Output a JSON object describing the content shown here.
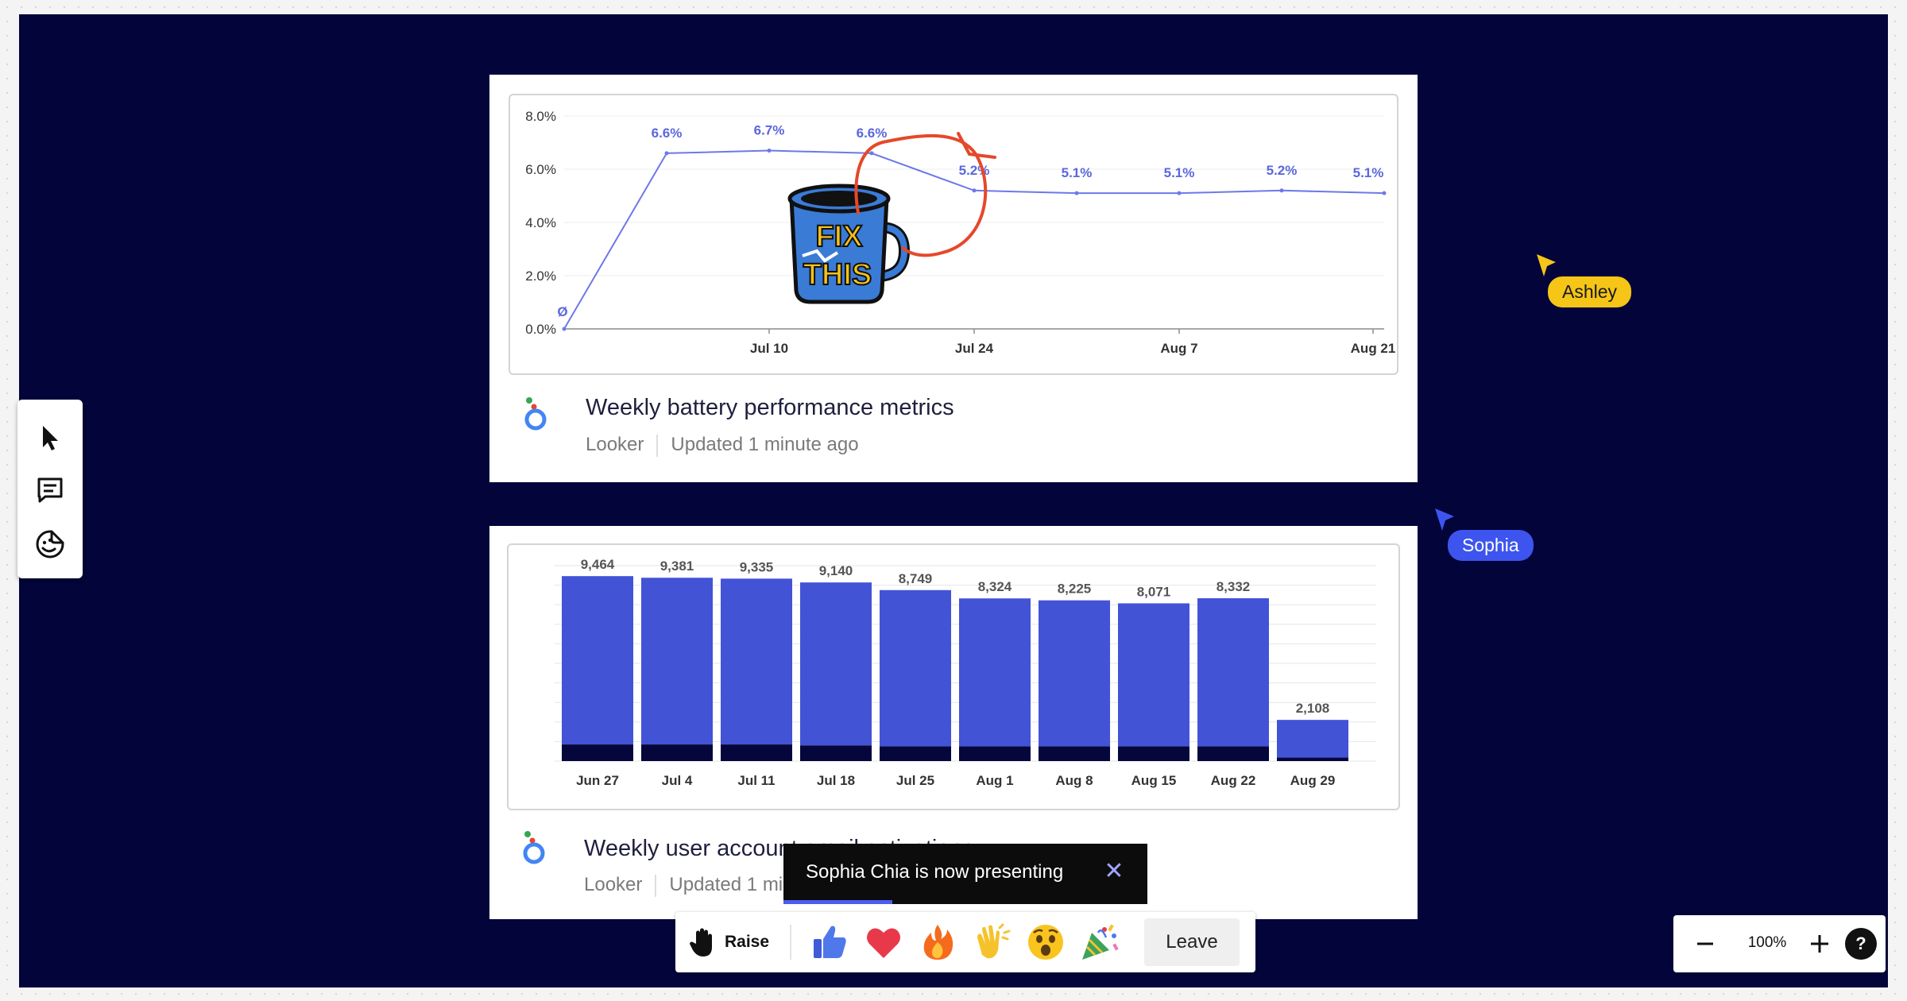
{
  "cards": [
    {
      "title": "Weekly battery performance metrics",
      "source": "Looker",
      "updated": "Updated 1 minute ago"
    },
    {
      "title": "Weekly user account email activations",
      "source": "Looker",
      "updated": "Updated 1 minute ago"
    }
  ],
  "chart_data": [
    {
      "type": "line",
      "x_labels": [
        "Jul 10",
        "Jul 24",
        "Aug 7",
        "Aug 21"
      ],
      "y_ticks": [
        "0.0%",
        "2.0%",
        "4.0%",
        "6.0%",
        "8.0%"
      ],
      "ylim": [
        0,
        8
      ],
      "grid": true,
      "series": [
        {
          "values": [
            0,
            6.6,
            6.7,
            6.6,
            5.2,
            5.1,
            5.1,
            5.2,
            5.1
          ],
          "labels": [
            "Ø",
            "6.6%",
            "6.7%",
            "6.6%",
            "5.2%",
            "5.1%",
            "5.1%",
            "5.2%",
            "5.1%"
          ],
          "color": "#6e78e8"
        }
      ]
    },
    {
      "type": "bar",
      "stacked": true,
      "categories": [
        "Jun 27",
        "Jul 4",
        "Jul 11",
        "Jul 18",
        "Jul 25",
        "Aug 1",
        "Aug 8",
        "Aug 15",
        "Aug 22",
        "Aug 29"
      ],
      "totals": [
        9464,
        9381,
        9335,
        9140,
        8749,
        8324,
        8225,
        8071,
        8332,
        2108
      ],
      "total_labels": [
        "9,464",
        "9,381",
        "9,335",
        "9,140",
        "8,749",
        "8,324",
        "8,225",
        "8,071",
        "8,332",
        "2,108"
      ],
      "base_values": [
        850,
        850,
        850,
        800,
        750,
        750,
        750,
        750,
        750,
        180
      ],
      "ylim": [
        0,
        10000
      ],
      "grid": true,
      "colors": {
        "top": "#4353d6",
        "base": "#05063b"
      }
    }
  ],
  "sticker": {
    "line1": "FIX",
    "line2": "THIS"
  },
  "cursors": [
    {
      "name": "Ashley",
      "color": "#f5c518"
    },
    {
      "name": "Sophia",
      "color": "#3d55ee"
    }
  ],
  "toast": {
    "message": "Sophia Chia is now presenting",
    "progress": 0.3
  },
  "reactions": {
    "raise_label": "Raise",
    "emojis": [
      "thumbs-up",
      "heart",
      "fire",
      "clapping-hands",
      "surprised-face",
      "party-popper"
    ],
    "leave_label": "Leave"
  },
  "zoom": {
    "level": "100%"
  },
  "toolbar": {
    "tools": [
      "select",
      "comment",
      "sticker"
    ]
  },
  "colors": {
    "stage": "#03043a",
    "accent": "#4353d6"
  }
}
